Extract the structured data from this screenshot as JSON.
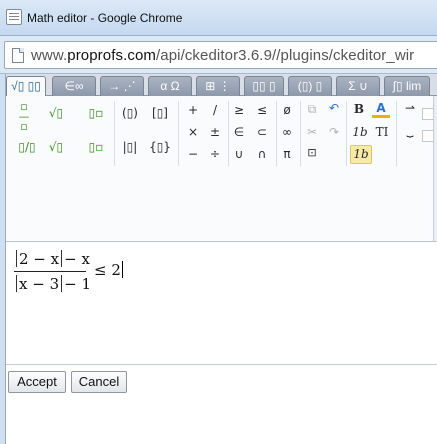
{
  "window": {
    "title": "Math editor - Google Chrome",
    "url_prefix": "www.",
    "url_domain": "proprofs.com",
    "url_path": "/api/ckeditor3.6.9//plugins/ckeditor_wir"
  },
  "tabs": [
    {
      "label": "√▯ ▯▯"
    },
    {
      "label": "∈∞"
    },
    {
      "label": "→ ⋰"
    },
    {
      "label": "α Ω"
    },
    {
      "label": "⊞ ⋮"
    },
    {
      "label": "▯▯ ▯"
    },
    {
      "label": "(▯) ▯"
    },
    {
      "label": "Σ ∪"
    },
    {
      "label": "∫▯ lim"
    }
  ],
  "toolbar": {
    "fraction": "▯/▯",
    "sqrt": "√▯",
    "superscript": "▯▫",
    "parens": "(▯)",
    "brackets": "[▯]",
    "plus": "+",
    "slash": "/",
    "geq": "≥",
    "leq": "≤",
    "emptyset": "ø",
    "times": "×",
    "plusminus": "±",
    "element_of": "∈",
    "subset": "⊂",
    "infinity": "∞",
    "minus": "−",
    "divide": "÷",
    "union": "∪",
    "intersection": "∩",
    "pi": "π",
    "bevelled_fraction": "▯/▯",
    "nth_root": "√▯",
    "subscript": "▯▫",
    "abs": "|▯|",
    "braces": "{▯}",
    "bold": "B",
    "font_color": "A",
    "italic": "1b",
    "text_mode": "TI",
    "italic_toggle": "1b"
  },
  "formula": {
    "num_a": "2 − x",
    "num_b": "− x",
    "den_a": "x − 3",
    "den_b": "− 1",
    "relation": "≤ 2"
  },
  "footer": {
    "accept_label": "Accept",
    "cancel_label": "Cancel"
  },
  "colors": {
    "accent_green": "#3d8f22",
    "active_tab_text": "#2a6a93",
    "undo_blue": "#2f6fcf"
  }
}
